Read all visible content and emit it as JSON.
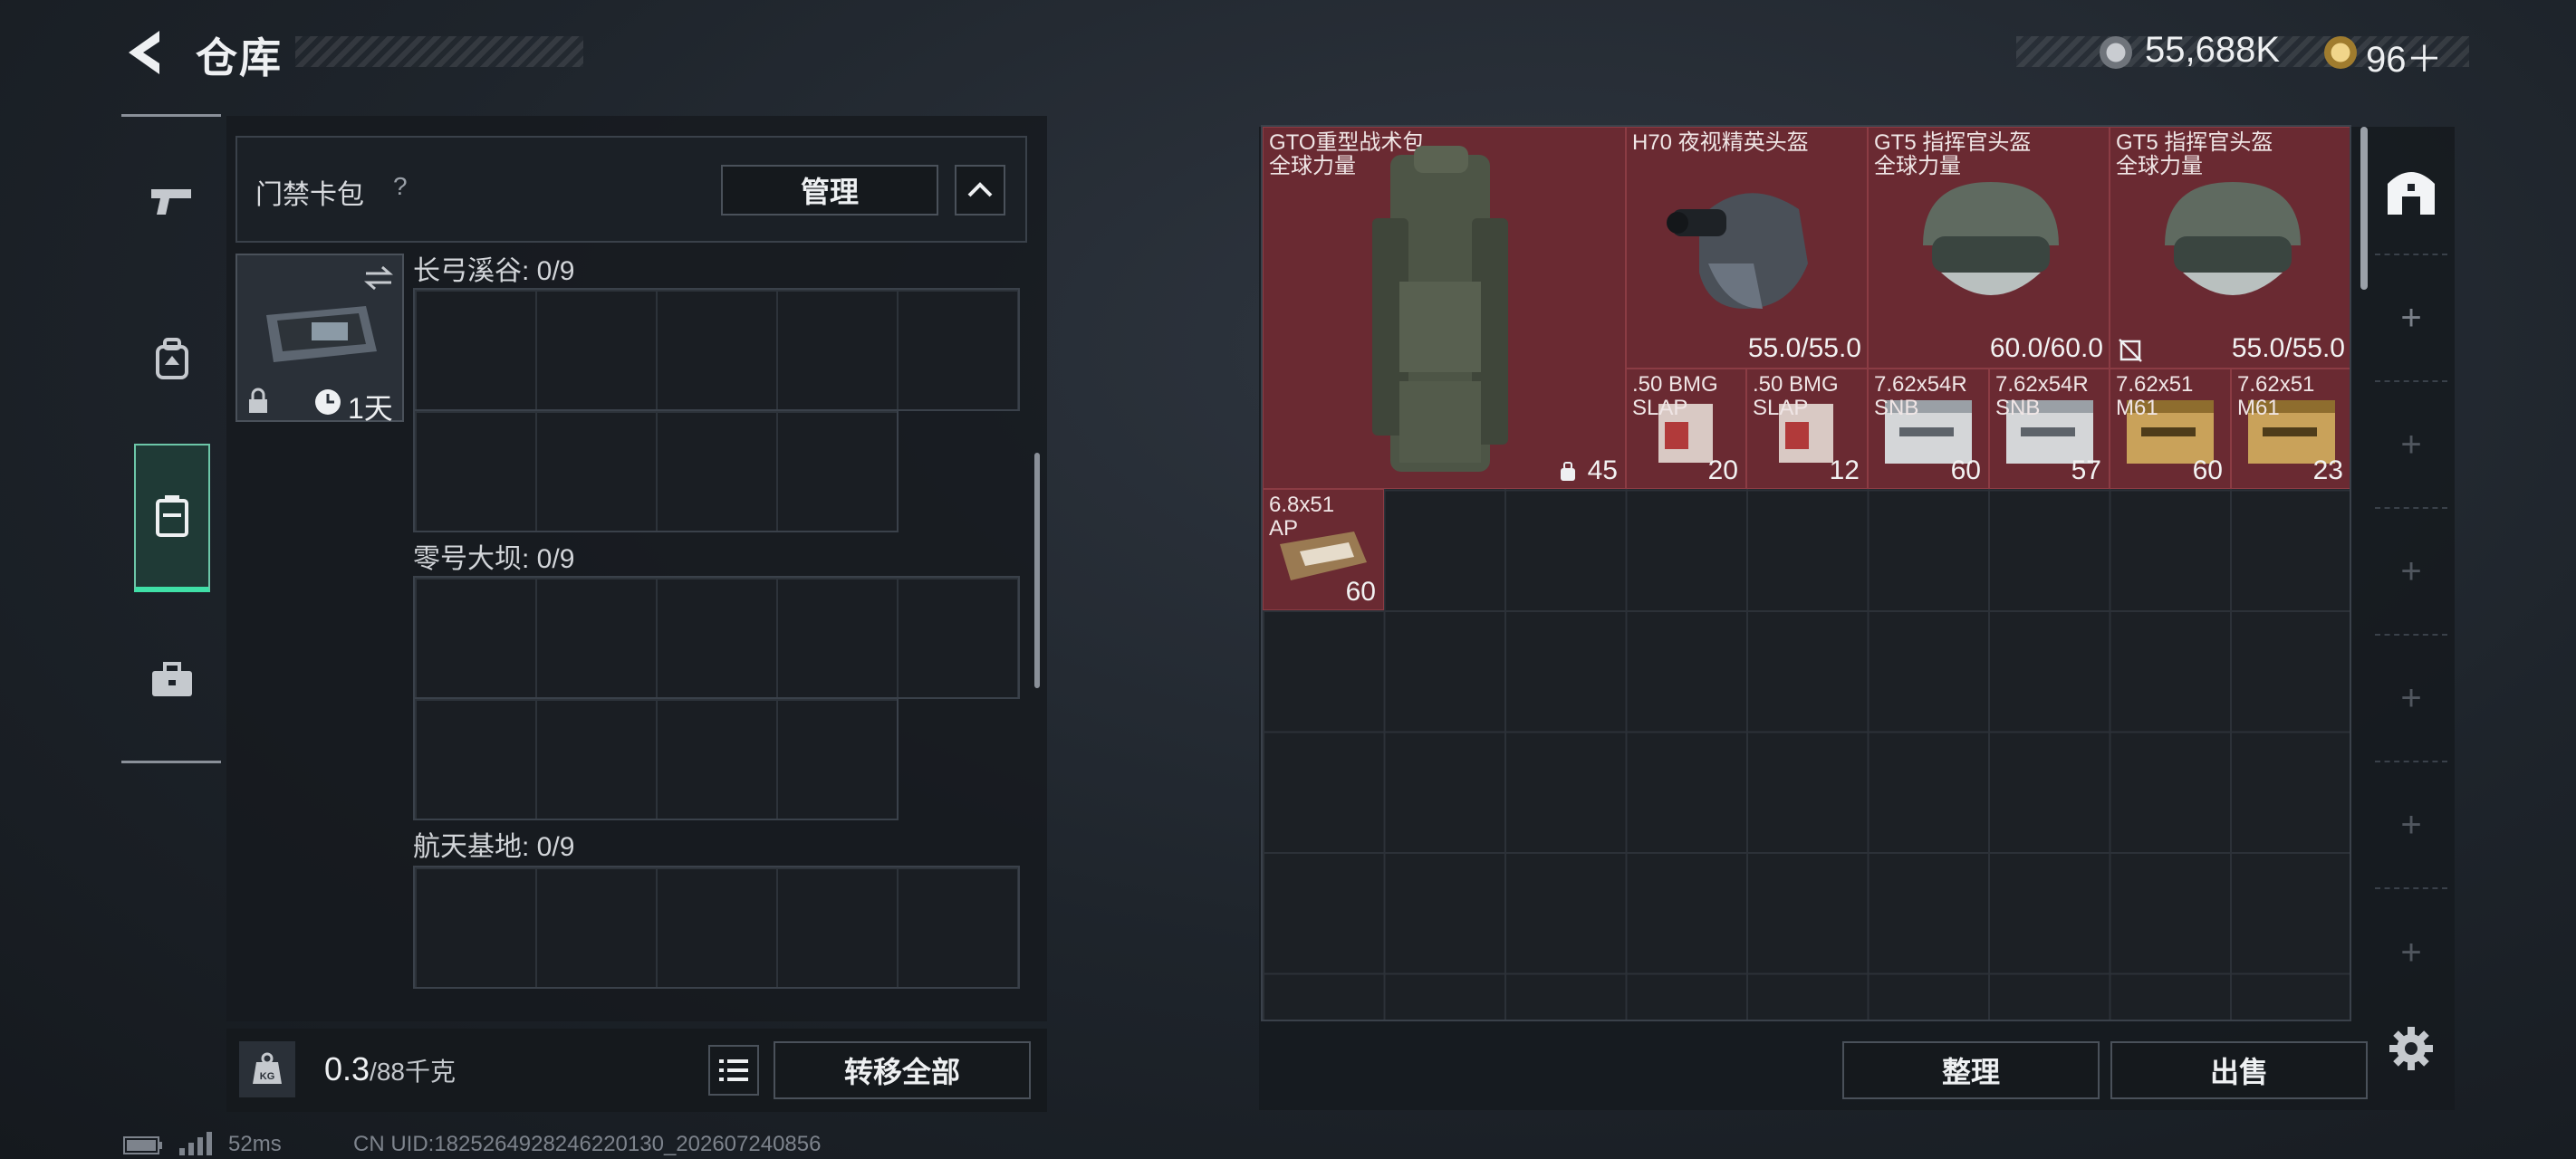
{
  "header": {
    "title": "仓库"
  },
  "currency": {
    "silver": "55,688K",
    "gold": "96＋"
  },
  "nav": {
    "items": [
      {
        "name": "weapons",
        "icon": "pistol-icon"
      },
      {
        "name": "equipment",
        "icon": "backpack-icon"
      },
      {
        "name": "containers",
        "icon": "case-icon",
        "active": true
      },
      {
        "name": "tools",
        "icon": "toolbox-icon"
      }
    ]
  },
  "keycard": {
    "title": "门禁卡包",
    "help": "?",
    "manage_label": "管理",
    "collapse_icon": "chevron-up-icon",
    "item": {
      "timer": "1天"
    },
    "sections": [
      {
        "title": "长弓溪谷: 0/9"
      },
      {
        "title": "零号大坝: 0/9"
      },
      {
        "title": "航天基地: 0/9"
      }
    ]
  },
  "capacity": {
    "current": "0.3",
    "max": "/88千克",
    "unit_icon": "KG"
  },
  "transfer_all_label": "转移全部",
  "stash": {
    "items": [
      {
        "name": "GTO重型战术包\n全球力量",
        "count": "45",
        "color": "#6a2a32"
      },
      {
        "name": "H70 夜视精英头盔",
        "stat": "55.0/55.0"
      },
      {
        "name": "GT5 指挥官头盔\n全球力量",
        "stat": "60.0/60.0"
      },
      {
        "name": "GT5 指挥官头盔\n全球力量",
        "stat": "55.0/55.0"
      },
      {
        "name": ".50 BMG\nSLAP",
        "count": "20"
      },
      {
        "name": ".50 BMG\nSLAP",
        "count": "12"
      },
      {
        "name": "7.62x54R\nSNB",
        "count": "60"
      },
      {
        "name": "7.62x54R\nSNB",
        "count": "57"
      },
      {
        "name": "7.62x51\nM61",
        "count": "60"
      },
      {
        "name": "7.62x51\nM61",
        "count": "23"
      },
      {
        "name": "6.8x51\nAP",
        "count": "60"
      }
    ]
  },
  "actions": {
    "sort_label": "整理",
    "sell_label": "出售"
  },
  "status": {
    "ping": "52ms",
    "uid": "CN UID:1825264928246220130_202607240856"
  },
  "colors": {
    "accent": "#3fe0a7",
    "item_bg": "#6a2a32"
  }
}
